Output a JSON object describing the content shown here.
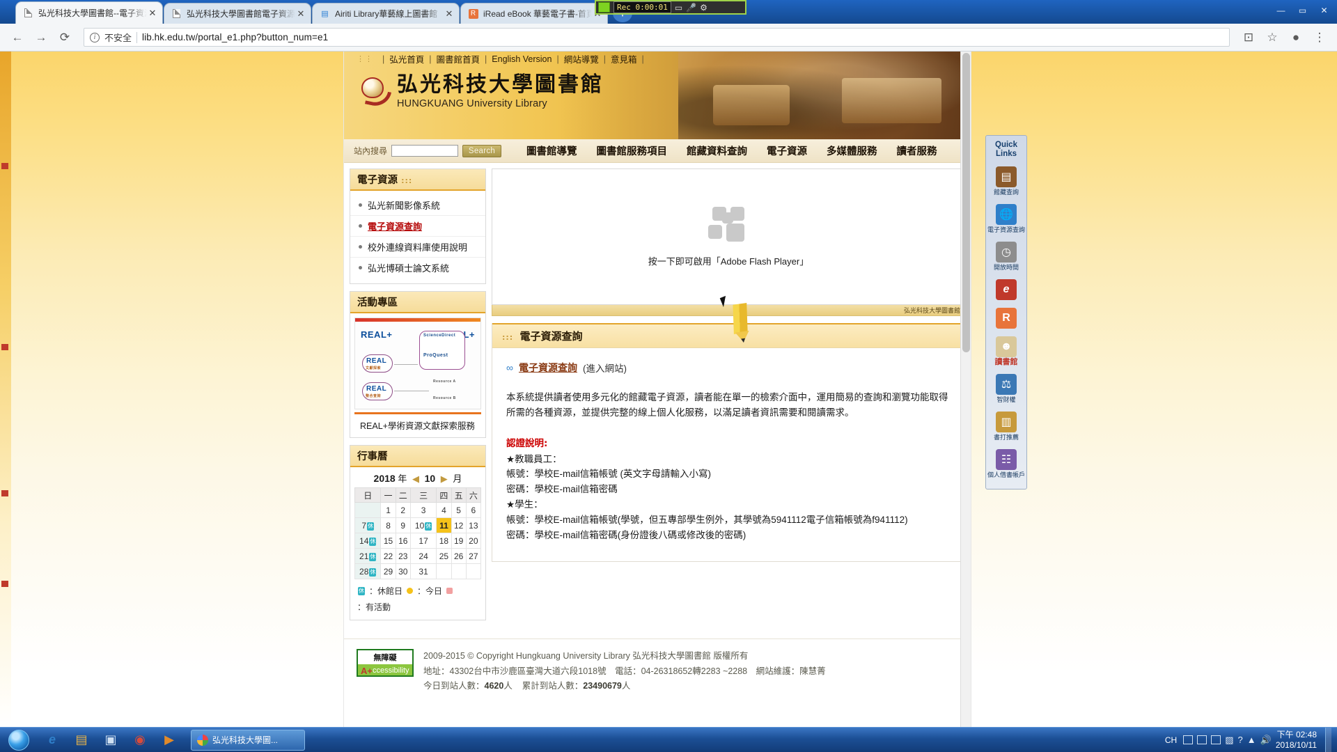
{
  "browser": {
    "tabs": [
      {
        "title": "弘光科技大學圖書館--電子資源",
        "favicon": "document-icon",
        "active": true
      },
      {
        "title": "弘光科技大學圖書館電子資源整",
        "favicon": "document-icon",
        "active": false
      },
      {
        "title": "Airiti Library華藝線上圖書館",
        "favicon": "airiti-icon",
        "active": false
      },
      {
        "title": "iRead eBook 華藝電子書-首頁",
        "favicon": "iread-icon",
        "active": false
      }
    ],
    "close_label": "✕",
    "newtab_label": "+",
    "window_controls": {
      "minimize": "—",
      "maximize": "▭",
      "close": "✕"
    },
    "nav": {
      "back": "←",
      "forward": "→",
      "reload": "⟳"
    },
    "omnibox": {
      "security_label": "不安全",
      "url": "lib.hk.edu.tw/portal_e1.php?button_num=e1",
      "info_icon": "i"
    },
    "toolbar_right": {
      "cast": "⊡",
      "star": "☆",
      "profile": "●",
      "menu": "⋮"
    },
    "recorder": {
      "time_label": "Rec 0:00:01"
    }
  },
  "site": {
    "topnav": [
      "弘光首頁",
      "圖書館首頁",
      "English Version",
      "網站導覽",
      "意見箱"
    ],
    "logo": {
      "cn": "弘光科技大學圖書館",
      "en": "HUNGKUANG University Library"
    },
    "search": {
      "label": "站內搜尋",
      "value": "",
      "placeholder": "",
      "button": "Search"
    },
    "mainnav": [
      "圖書館導覽",
      "圖書館服務項目",
      "館藏資料查詢",
      "電子資源",
      "多媒體服務",
      "讀者服務"
    ]
  },
  "sidebar": {
    "resources": {
      "title": "電子資源",
      "title_dots": ":::",
      "items": [
        {
          "label": "弘光新聞影像系統",
          "current": false
        },
        {
          "label": "電子資源查詢",
          "current": true
        },
        {
          "label": "校外連線資料庫使用說明",
          "current": false
        },
        {
          "label": "弘光博碩士論文系統",
          "current": false
        }
      ]
    },
    "activity": {
      "title": "活動專區",
      "promo_brand": "REAL",
      "promo_sub1": "文獻探索",
      "promo_sub2": "整合查詢",
      "promo_tag_left": "REAL+",
      "promo_tag_right": "REAL+",
      "promo_node_a": "Resource A",
      "promo_node_b": "Resource B",
      "promo_science": "ScienceDirect",
      "promo_proquest": "ProQuest",
      "caption": "REAL+學術資源文獻探索服務"
    },
    "calendar": {
      "title": "行事曆",
      "year": "2018",
      "year_unit": "年",
      "month": "10",
      "month_unit": "月",
      "prev_arrow": "◀",
      "next_arrow": "▶",
      "weekdays": [
        "日",
        "一",
        "二",
        "三",
        "四",
        "五",
        "六"
      ],
      "weeks": [
        [
          null,
          "1",
          "2",
          "3",
          "4",
          "5",
          "6"
        ],
        [
          "7",
          "8",
          "9",
          "10",
          "11",
          "12",
          "13"
        ],
        [
          "14",
          "15",
          "16",
          "17",
          "18",
          "19",
          "20"
        ],
        [
          "21",
          "22",
          "23",
          "24",
          "25",
          "26",
          "27"
        ],
        [
          "28",
          "29",
          "30",
          "31",
          null,
          null,
          null
        ]
      ],
      "holiday_days": [
        "7",
        "10",
        "14",
        "21",
        "28"
      ],
      "today": "11",
      "badge_text": "休",
      "legend": [
        {
          "mark": "休",
          "text": "：休館日"
        },
        {
          "mark": "dot-yellow",
          "text": "：今日"
        },
        {
          "mark": "dot-pink",
          "text": "：有活動"
        }
      ]
    }
  },
  "flash": {
    "message": "按一下即可啟用「Adobe Flash Player」",
    "caption": "弘光科技大學圖書館"
  },
  "main": {
    "heading": "電子資源查詢",
    "heading_dots": ":::",
    "link": {
      "text": "電子資源查詢",
      "suffix": "(進入網站)",
      "icon": "chain-icon"
    },
    "paragraph": "本系統提供讀者使用多元化的館藏電子資源，讀者能在單一的檢索介面中，運用簡易的查詢和瀏覽功能取得所需的各種資源，並提供完整的線上個人化服務，以滿足讀者資訊需要和閱讀需求。",
    "auth_title": "認證說明:",
    "auth_lines": [
      "★教職員工：",
      "帳號：學校E-mail信箱帳號 (英文字母請輸入小寫)",
      "密碼：學校E-mail信箱密碼",
      "★學生：",
      "帳號：學校E-mail信箱帳號(學號，但五專部學生例外，其學號為5941112電子信箱帳號為f941112)",
      "密碼：學校E-mail信箱密碼(身份證後八碼或修改後的密碼)"
    ]
  },
  "footer": {
    "badge": {
      "top": "無障礙",
      "bottom_a": "A",
      "bottom_plus": "+",
      "bottom_rest": "ccessibility"
    },
    "copyright": "2009-2015 © Copyright Hungkuang University Library  弘光科技大學圖書館 版權所有",
    "address": "地址：43302台中市沙鹿區臺灣大道六段1018號　電話：04-26318652轉2283 ~2288　網站維護：陳慧菁",
    "stats_today_label": "今日到站人數：",
    "stats_today_value": "4620",
    "stats_today_unit": "人",
    "stats_total_label": "累計到站人數：",
    "stats_total_value": "23490679",
    "stats_total_unit": "人"
  },
  "quicklinks": {
    "title_line1": "Quick",
    "title_line2": "Links",
    "items": [
      {
        "label": "館藏查詢",
        "icon": "books-icon",
        "color": "#8b5a2b",
        "glyph": "📚"
      },
      {
        "label": "電子資源查詢",
        "icon": "globe-icon",
        "color": "#2f7fc9",
        "glyph": "🌐"
      },
      {
        "label": "開放時間",
        "icon": "clock-icon",
        "color": "#6b6b6b",
        "glyph": "🕐"
      },
      {
        "label": "",
        "icon": "ebook-red-icon",
        "color": "#c0392b",
        "glyph": "e"
      },
      {
        "label": "",
        "icon": "iread-icon",
        "color": "#e8743b",
        "glyph": "R"
      },
      {
        "label": "讀書館",
        "icon": "reading-icon",
        "color": "#5b8f3a",
        "glyph": "🐵"
      },
      {
        "label": "智財權",
        "icon": "shield-icon",
        "color": "#3b78b5",
        "glyph": "⚖"
      },
      {
        "label": "書打推薦",
        "icon": "book-rec-icon",
        "color": "#c79a3c",
        "glyph": "📖"
      },
      {
        "label": "個人借書帳戶",
        "icon": "account-icon",
        "color": "#7a5ba8",
        "glyph": "👤"
      }
    ]
  },
  "taskbar": {
    "start": "start-orb",
    "pinned": [
      {
        "name": "internet-explorer-icon",
        "glyph": "e",
        "color": "#2f7fc9"
      },
      {
        "name": "file-explorer-icon",
        "glyph": "🗂",
        "color": "#e8b44a"
      },
      {
        "name": "printer-icon",
        "glyph": "🖨",
        "color": "#bfd4e8"
      },
      {
        "name": "chrome-icon",
        "glyph": "◉",
        "color": "#d94b3a"
      },
      {
        "name": "notepad-icon",
        "glyph": "▤",
        "color": "#b9c9da"
      },
      {
        "name": "media-player-icon",
        "glyph": "▶",
        "color": "#e08a2a"
      }
    ],
    "window_button": {
      "label": "弘光科技大學圖..."
    },
    "tray": {
      "ime": "CH",
      "icons": [
        "⌨",
        "▦",
        "◧",
        "◨",
        "🔊",
        "❓",
        "▲"
      ],
      "time": "下午 02:48",
      "date": "2018/10/11"
    }
  },
  "colors": {
    "brand_gold": "#e3a42b",
    "accent_red": "#b60b0b",
    "link_brown": "#8a3b14",
    "today_yellow": "#f5c21a",
    "holiday_teal": "#2fb5c4"
  }
}
